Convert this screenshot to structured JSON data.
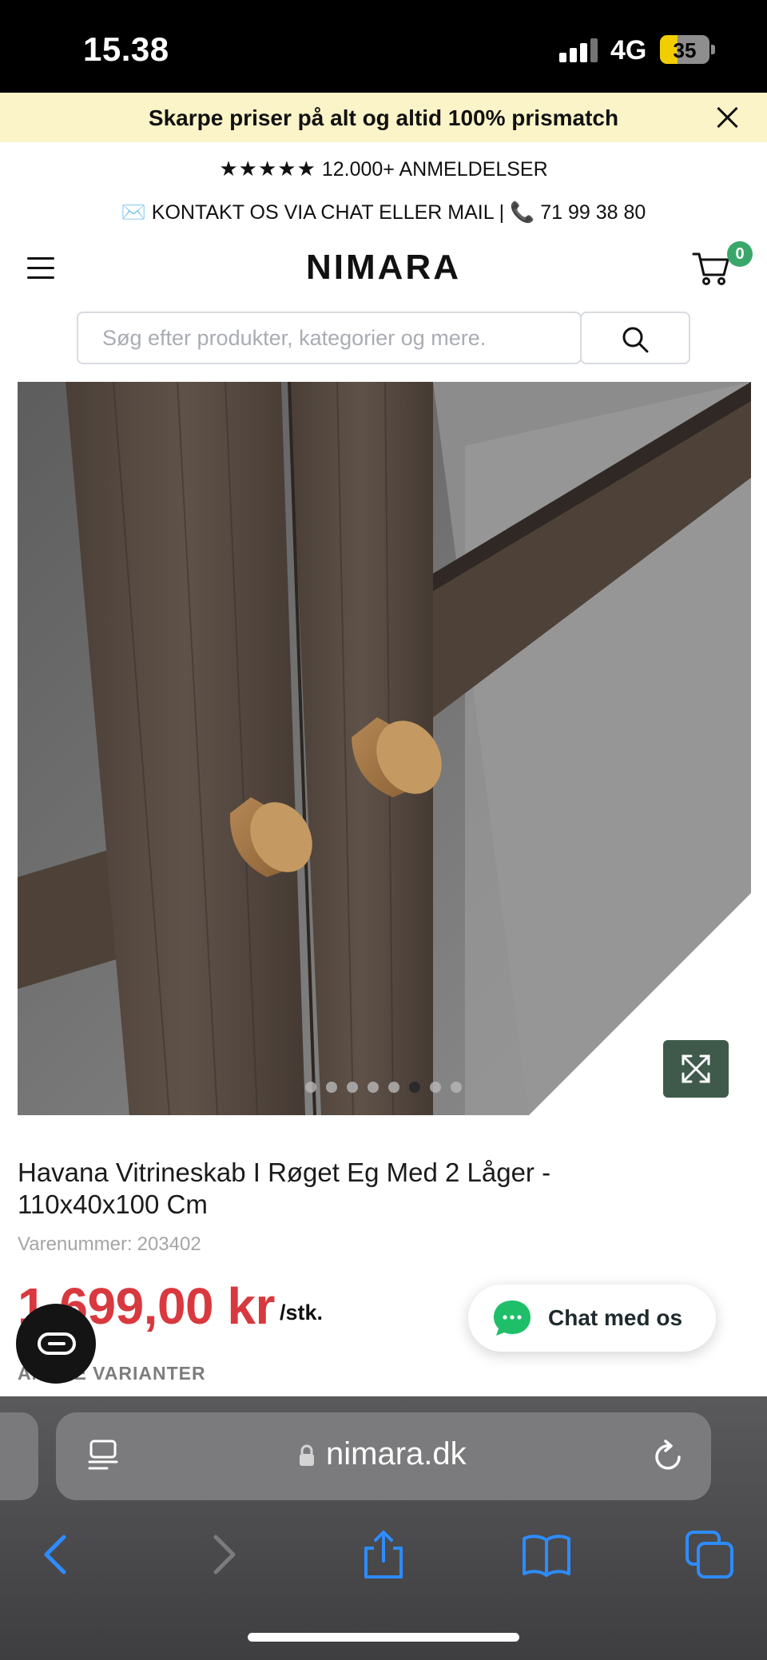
{
  "status_bar": {
    "time": "15.38",
    "network": "4G",
    "battery_level": "35",
    "battery_fraction": 0.35
  },
  "promo_banner": {
    "text": "Skarpe priser på alt og altid 100% prismatch"
  },
  "trust": {
    "stars": "★★★★★",
    "reviews_text": "12.000+ ANMELDELSER",
    "contact_icon_mail": "✉️",
    "contact_text": "KONTAKT OS VIA CHAT ELLER MAIL |",
    "contact_icon_phone": "📞",
    "phone": "71 99 38 80"
  },
  "header": {
    "logo": "NIMARA",
    "cart_count": "0"
  },
  "search": {
    "placeholder": "Søg efter produkter, kategorier og mere."
  },
  "gallery": {
    "image_count": 8,
    "active_index": 5
  },
  "product": {
    "title": "Havana Vitrineskab I Røget Eg Med 2 Låger - 110x40x100 Cm",
    "sku_label": "Varenummer:",
    "sku": "203402",
    "price": "1.699,00 kr",
    "unit": "/stk.",
    "variants_label": "ANDRE VARIANTER"
  },
  "chat": {
    "label": "Chat med os"
  },
  "safari": {
    "url": "nimara.dk"
  },
  "colors": {
    "promo_bg": "#fbf4c8",
    "price": "#d8393f",
    "cart_badge": "#3aa76a",
    "expand_button": "#3f5a4a",
    "safari_blue": "#2d8cff"
  }
}
